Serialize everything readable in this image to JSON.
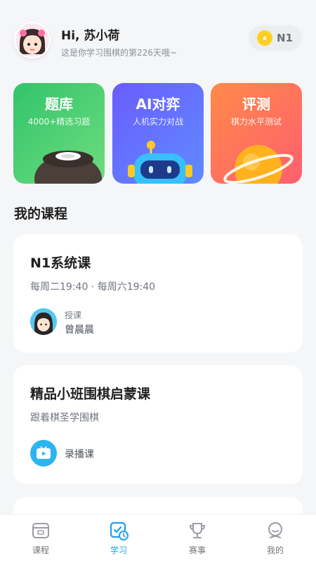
{
  "header": {
    "greeting": "Hi, 苏小荷",
    "subtitle": "这是你学习围棋的第226天哦~",
    "level": "N1"
  },
  "features": [
    {
      "title": "题库",
      "desc": "4000+精选习题"
    },
    {
      "title": "AI对弈",
      "desc": "人机实力对战"
    },
    {
      "title": "评测",
      "desc": "棋力水平测试"
    }
  ],
  "section_title": "我的课程",
  "courses": [
    {
      "title": "N1系统课",
      "schedule": "每周二19:40 · 每周六19:40",
      "teacher_label": "授课",
      "teacher_name": "曾晨晨"
    },
    {
      "title": "精品小班围棋启蒙课",
      "subtitle": "跟着棋圣学围棋",
      "type_label": "录播课"
    }
  ],
  "tabs": [
    {
      "label": "课程",
      "icon": "course-icon"
    },
    {
      "label": "学习",
      "icon": "study-icon"
    },
    {
      "label": "赛事",
      "icon": "trophy-icon"
    },
    {
      "label": "我的",
      "icon": "profile-icon"
    }
  ],
  "colors": {
    "accent": "#1e9ff2",
    "bank": "#32c46b",
    "ai": "#6a5cff",
    "eval": "#ff6a5c"
  }
}
